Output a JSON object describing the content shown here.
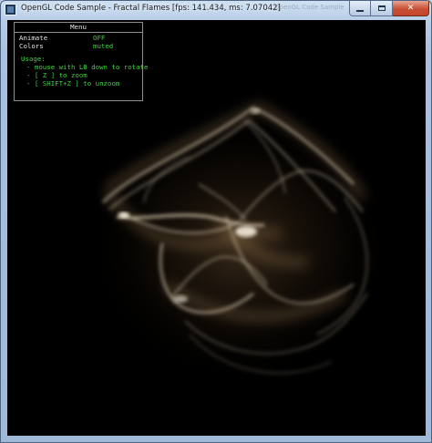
{
  "window": {
    "title": "OpenGL Code Sample - Fractal Flames [fps: 141.434, ms: 7.07042]",
    "background_tab": "OpenGL Code Sample",
    "controls": {
      "minimize": "—",
      "maximize": "□",
      "close": "✕"
    }
  },
  "menu": {
    "title": "Menu",
    "items": [
      {
        "label": "Animate",
        "value": "OFF"
      },
      {
        "label": "Colors",
        "value": "muted"
      }
    ],
    "usage_title": "Usage:",
    "usage_lines": [
      "- mouse with LB down to rotate",
      "- [ Z ] to zoom",
      "- [ SHIFT+Z ] to unzoom"
    ]
  },
  "colors": {
    "viewport_bg": "#000000",
    "menu_text": "#e8e8e8",
    "menu_value": "#3fd23f",
    "flame_primary": "#f3e2c6",
    "flame_shadow": "#6b4b2a"
  },
  "icons": {
    "app": "opengl-app-icon",
    "minimize": "minimize-icon",
    "maximize": "maximize-icon",
    "close": "close-icon"
  }
}
